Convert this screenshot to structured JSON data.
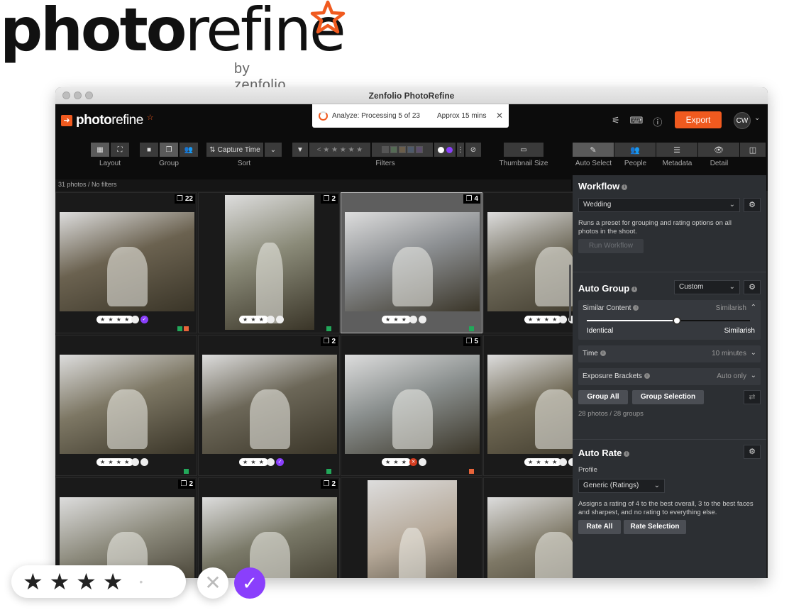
{
  "brand": {
    "name_bold": "photo",
    "name_light": "refine",
    "sub": "by zenfolio"
  },
  "window": {
    "title": "Zenfolio PhotoRefine"
  },
  "app": {
    "logo_bold": "photo",
    "logo_light": "refine",
    "notice": {
      "text": "Analyze: Processing 5 of 23",
      "approx": "Approx 15 mins",
      "close": "✕"
    },
    "export_label": "Export",
    "avatar": "CW"
  },
  "toolbar": {
    "layout_label": "Layout",
    "group_label": "Group",
    "sort_value": "Capture Time",
    "sort_label": "Sort",
    "filters_label": "Filters",
    "thumbnail_label": "Thumbnail Size",
    "filter_stars": "< ★ ★ ★ ★ ★",
    "filter_colors": [
      "#555555",
      "#556b55",
      "#6b5e4b",
      "#4e5a6b",
      "#5b4e6b"
    ]
  },
  "right_tabs": [
    {
      "label": "Auto Select",
      "icon": "✎"
    },
    {
      "label": "People",
      "icon": "👥"
    },
    {
      "label": "Metadata",
      "icon": "☰"
    },
    {
      "label": "Detail",
      "icon": "👁"
    },
    {
      "label": "",
      "icon": "◫"
    }
  ],
  "status": "31 photos / No filters",
  "photos": [
    {
      "count": "22",
      "stars": "★ ★ ★ ★",
      "marks": [
        "",
        "✓"
      ],
      "flags": [
        "#22a85a",
        "#e8643a"
      ],
      "bg": "#6b6250"
    },
    {
      "count": "2",
      "stars": "★ ★ ★",
      "marks": [
        "",
        ""
      ],
      "flags": [
        "#22a85a"
      ],
      "bg": "#8a8a78"
    },
    {
      "count": "4",
      "stars": "★ ★ ★",
      "marks": [
        "",
        ""
      ],
      "flags": [
        "#22a85a"
      ],
      "bg": "#8c8f92"
    },
    {
      "count": "",
      "stars": "★ ★ ★ ★",
      "marks": [
        "",
        ""
      ],
      "flags": [],
      "bg": "#6f6a5a"
    },
    {
      "count": "",
      "stars": "★ ★ ★ ★",
      "marks": [
        "",
        ""
      ],
      "flags": [
        "#22a85a"
      ],
      "bg": "#7d7764"
    },
    {
      "count": "2",
      "stars": "★ ★ ★",
      "marks": [
        "",
        "✓"
      ],
      "flags": [
        "#22a85a"
      ],
      "bg": "#6c6758"
    },
    {
      "count": "5",
      "stars": "★ ★ ★",
      "marks": [
        "✕",
        ""
      ],
      "flags": [
        "#e8643a"
      ],
      "bg": "#8a8f8e"
    },
    {
      "count": "",
      "stars": "★ ★ ★ ★",
      "marks": [
        "",
        ""
      ],
      "flags": [],
      "bg": "#6f6854"
    },
    {
      "count": "2",
      "stars": "",
      "marks": [],
      "flags": [],
      "bg": "#8d8b7d"
    },
    {
      "count": "2",
      "stars": "",
      "marks": [],
      "flags": [],
      "bg": "#7b7a69"
    },
    {
      "count": "",
      "stars": "",
      "marks": [],
      "flags": [],
      "bg": "#b5a898"
    },
    {
      "count": "",
      "stars": "",
      "marks": [],
      "flags": [],
      "bg": "#7e7866"
    }
  ],
  "panel": {
    "workflow_title": "Workflow",
    "workflow_value": "Wedding",
    "workflow_desc": "Runs a preset for grouping and rating options on all photos in the shoot.",
    "run_label": "Run Workflow",
    "autogroup_title": "Auto Group",
    "autogroup_value": "Custom",
    "similar_label": "Similar Content",
    "similar_value": "Similarish",
    "slider_left": "Identical",
    "slider_right": "Similarish",
    "slider_level": 0.55,
    "time_label": "Time",
    "time_value": "10 minutes",
    "exposure_label": "Exposure Brackets",
    "exposure_value": "Auto only",
    "group_all": "Group All",
    "group_selection": "Group Selection",
    "group_stats": "28 photos / 28 groups",
    "autorate_title": "Auto Rate",
    "profile_label": "Profile",
    "profile_value": "Generic (Ratings)",
    "rate_desc": "Assigns a rating of 4 to the best overall, 3 to the best faces and sharpest, and no rating to everything else.",
    "rate_all": "Rate All",
    "rate_selection": "Rate Selection"
  },
  "overlay": {
    "stars": "★ ★ ★ ★",
    "dot": "•",
    "reject": "✕",
    "accept": "✓"
  }
}
